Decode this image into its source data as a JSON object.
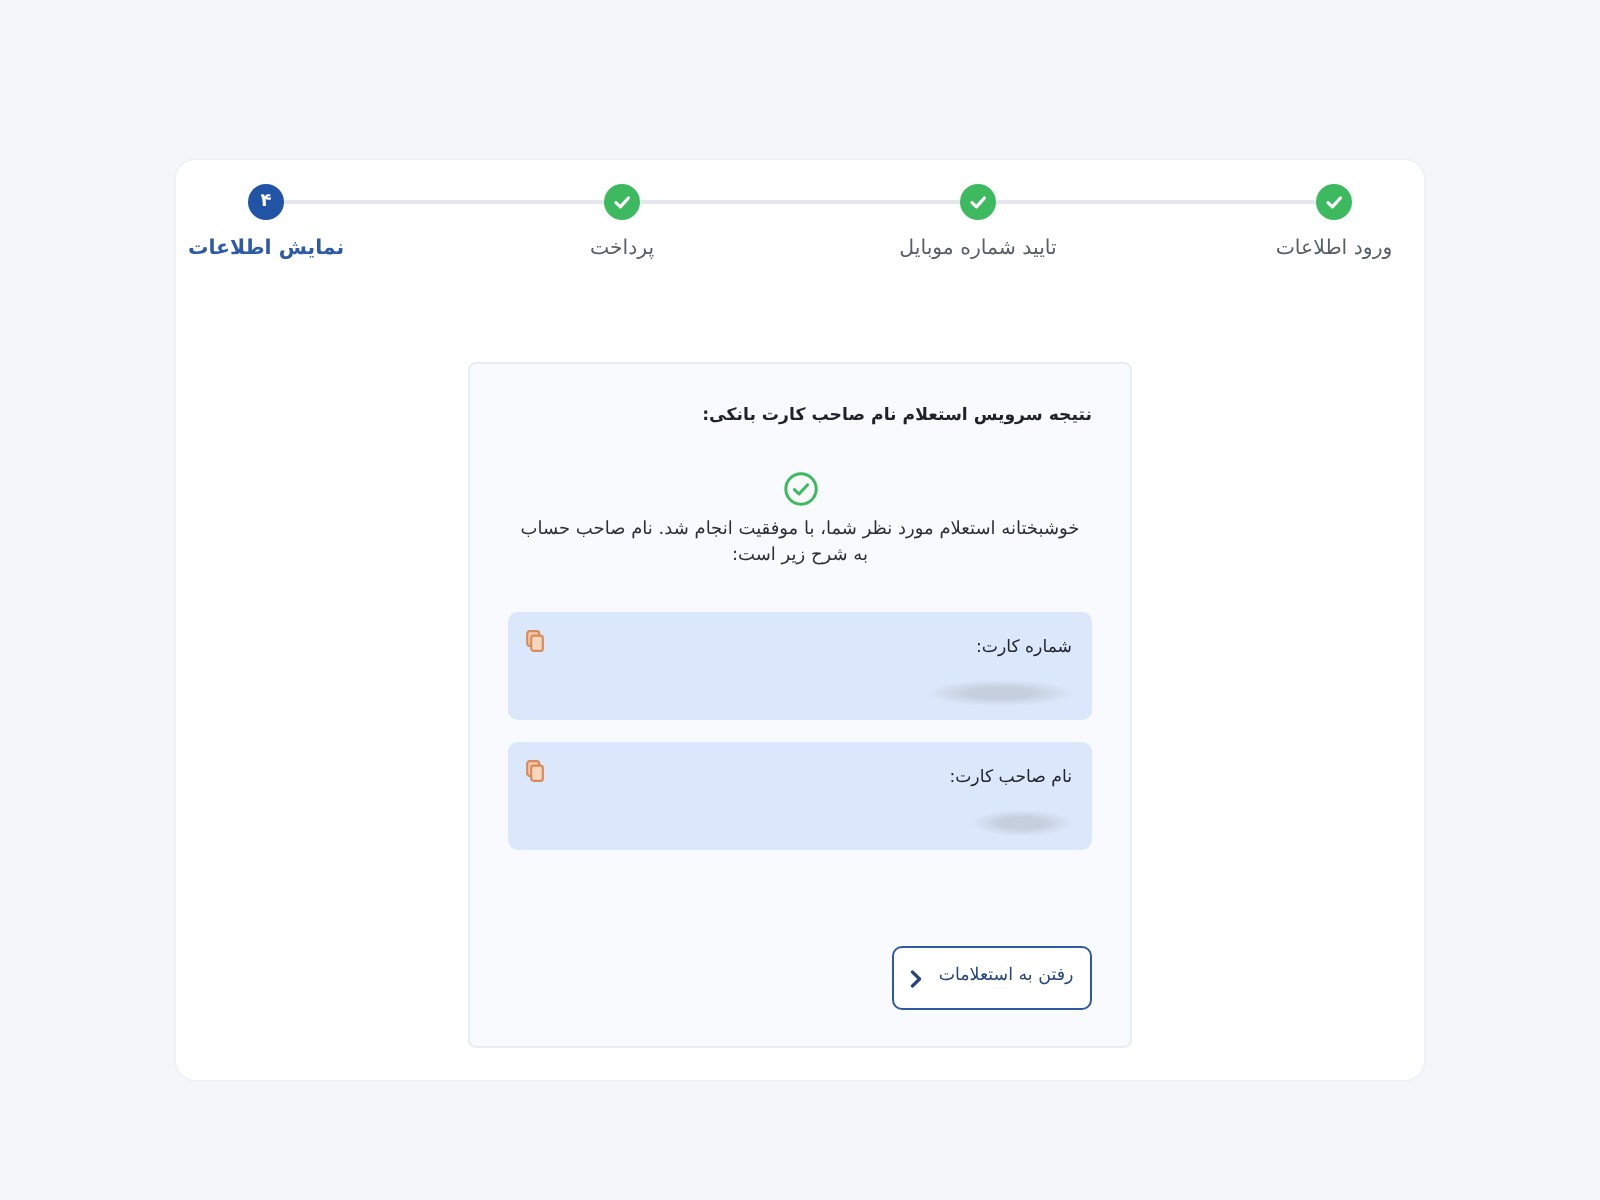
{
  "steps": [
    {
      "label": "ورود اطلاعات",
      "done": true
    },
    {
      "label": "تایید شماره موبایل",
      "done": true
    },
    {
      "label": "پرداخت",
      "done": true
    },
    {
      "label": "نمایش اطلاعات",
      "done": false,
      "number": "۴"
    }
  ],
  "result": {
    "title": "نتیجه سرویس استعلام نام صاحب کارت بانکی:",
    "message": "خوشبختانه استعلام مورد نظر شما، با موفقیت انجام شد. نام صاحب حساب به شرح زیر است:",
    "fields": [
      {
        "label": "شماره کارت:",
        "kind": "card_number"
      },
      {
        "label": "نام صاحب کارت:",
        "kind": "holder_name"
      }
    ],
    "button": "رفتن به استعلامات"
  }
}
